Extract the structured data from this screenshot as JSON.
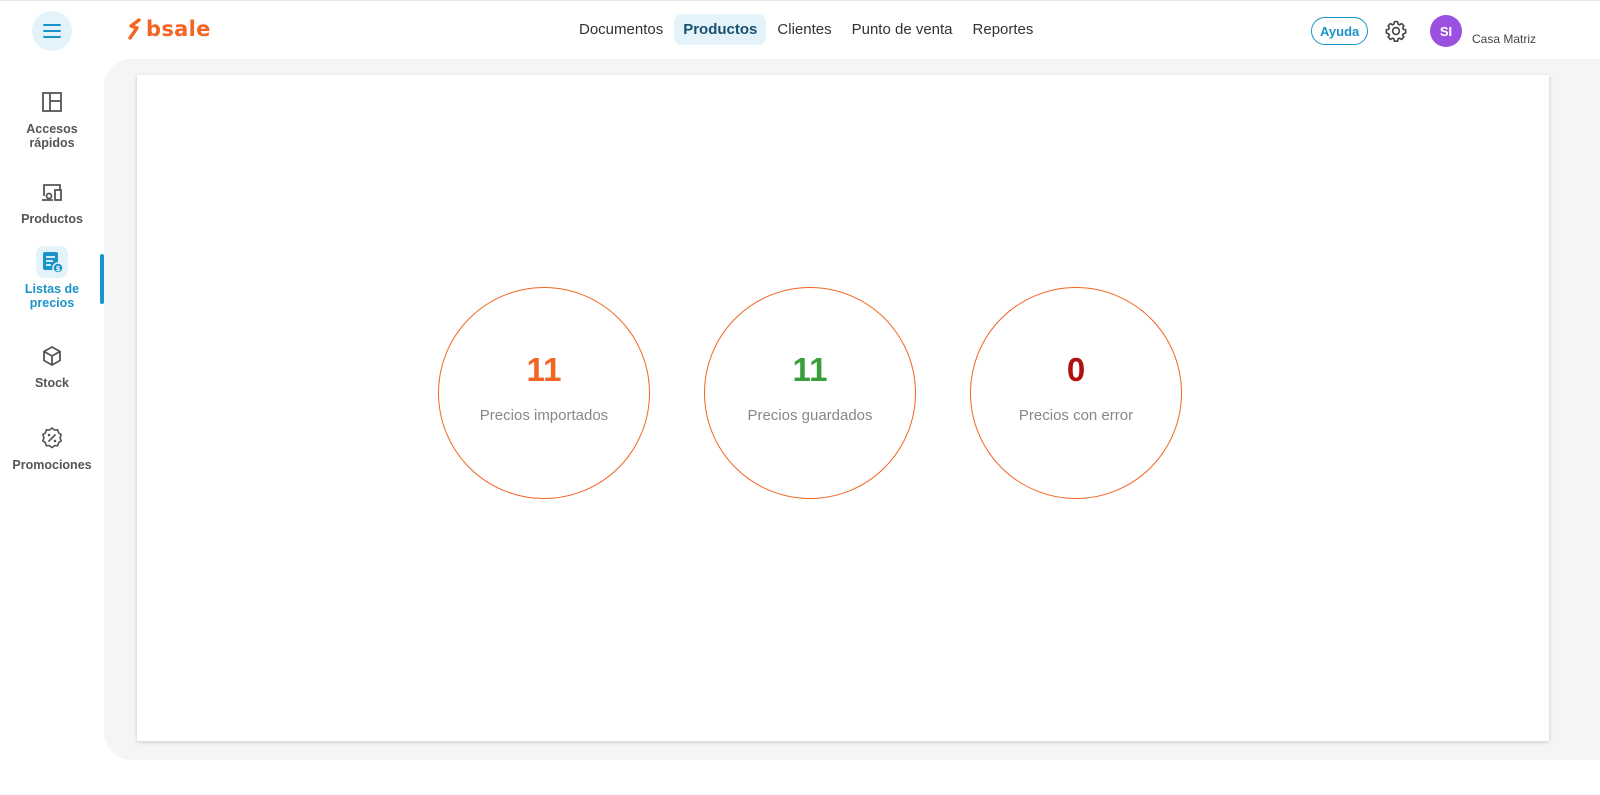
{
  "header": {
    "logo_text": "bsale",
    "nav": [
      {
        "label": "Documentos",
        "active": false
      },
      {
        "label": "Productos",
        "active": true
      },
      {
        "label": "Clientes",
        "active": false
      },
      {
        "label": "Punto de venta",
        "active": false
      },
      {
        "label": "Reportes",
        "active": false
      }
    ],
    "help_label": "Ayuda",
    "avatar_initials": "SI",
    "branch": "Casa Matriz"
  },
  "sidebar": {
    "items": [
      {
        "label": "Accesos rápidos",
        "icon": "layout-icon",
        "active": false
      },
      {
        "label": "Productos",
        "icon": "products-icon",
        "active": false
      },
      {
        "label": "Listas de precios",
        "icon": "price-list-icon",
        "active": true
      },
      {
        "label": "Stock",
        "icon": "box-icon",
        "active": false
      },
      {
        "label": "Promociones",
        "icon": "discount-badge-icon",
        "active": false
      }
    ]
  },
  "stats": [
    {
      "value": "11",
      "label": "Precios importados",
      "color": "#f26522"
    },
    {
      "value": "11",
      "label": "Precios guardados",
      "color": "#3a9e3a"
    },
    {
      "value": "0",
      "label": "Precios con error",
      "color": "#b01010"
    }
  ],
  "colors": {
    "brand": "#f26522",
    "accent": "#1a94c8",
    "avatar": "#9b51e0"
  }
}
